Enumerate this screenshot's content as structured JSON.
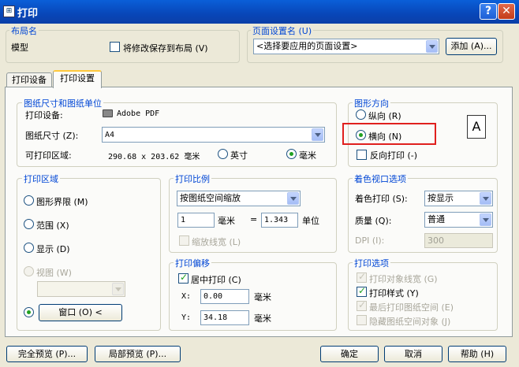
{
  "window": {
    "title": "打印",
    "help_btn": "?",
    "close_btn": "✕"
  },
  "layout_name": {
    "legend": "布局名",
    "name": "模型",
    "save_changes_label": "将修改保存到布局 (V)",
    "save_changes_checked": false
  },
  "page_setup": {
    "legend": "页面设置名 (U)",
    "selected": "<选择要应用的页面设置>",
    "add_button": "添加 (A)..."
  },
  "tabs": [
    {
      "label": "打印设备"
    },
    {
      "label": "打印设置"
    }
  ],
  "paper": {
    "legend": "图纸尺寸和图纸单位",
    "device_label": "打印设备:",
    "device_value": "Adobe PDF",
    "size_label": "图纸尺寸 (Z):",
    "size_value": "A4",
    "printable_label": "可打印区域:",
    "printable_value": "290.68 x 203.62 毫米",
    "unit_inch": "英寸",
    "unit_mm": "毫米",
    "selected_unit": "毫米"
  },
  "orientation": {
    "legend": "图形方向",
    "portrait": "纵向 (R)",
    "landscape": "横向 (N)",
    "selected": "横向",
    "reverse_label": "反向打印 (-)",
    "reverse_checked": false,
    "preview_glyph": "A",
    "highlight_color": "#e0201e"
  },
  "plot_area": {
    "legend": "打印区域",
    "options": [
      "图形界限 (M)",
      "范围 (X)",
      "显示 (D)",
      "视图 (W)"
    ],
    "window_button": "窗口 (O) <",
    "selected": "窗口"
  },
  "plot_scale": {
    "legend": "打印比例",
    "scale_value": "按图纸空间缩放",
    "value_1": "1",
    "unit_mm": "毫米",
    "equals": "=",
    "value_2": "1.343",
    "unit_label": "单位",
    "scale_lineweights": "缩放线宽 (L)",
    "scale_lineweights_checked": false
  },
  "plot_offset": {
    "legend": "打印偏移",
    "center_label": "居中打印 (C)",
    "center_checked": true,
    "x_label": "X:",
    "x_value": "0.00",
    "y_label": "Y:",
    "y_value": "34.18",
    "unit": "毫米"
  },
  "shaded": {
    "legend": "着色视口选项",
    "shade_label": "着色打印 (S):",
    "shade_value": "按显示",
    "quality_label": "质量 (Q):",
    "quality_value": "普通",
    "dpi_label": "DPI (I):",
    "dpi_value": "300"
  },
  "plot_options": {
    "legend": "打印选项",
    "items": [
      {
        "label": "打印对象线宽 (G)",
        "checked": true,
        "enabled": false
      },
      {
        "label": "打印样式 (Y)",
        "checked": true,
        "enabled": true
      },
      {
        "label": "最后打印图纸空间 (E)",
        "checked": true,
        "enabled": false
      },
      {
        "label": "隐藏图纸空间对象 (J)",
        "checked": false,
        "enabled": false
      }
    ]
  },
  "footer": {
    "full_preview": "完全预览 (P)...",
    "partial_preview": "局部预览 (P)...",
    "ok": "确定",
    "cancel": "取消",
    "help": "帮助 (H)"
  }
}
